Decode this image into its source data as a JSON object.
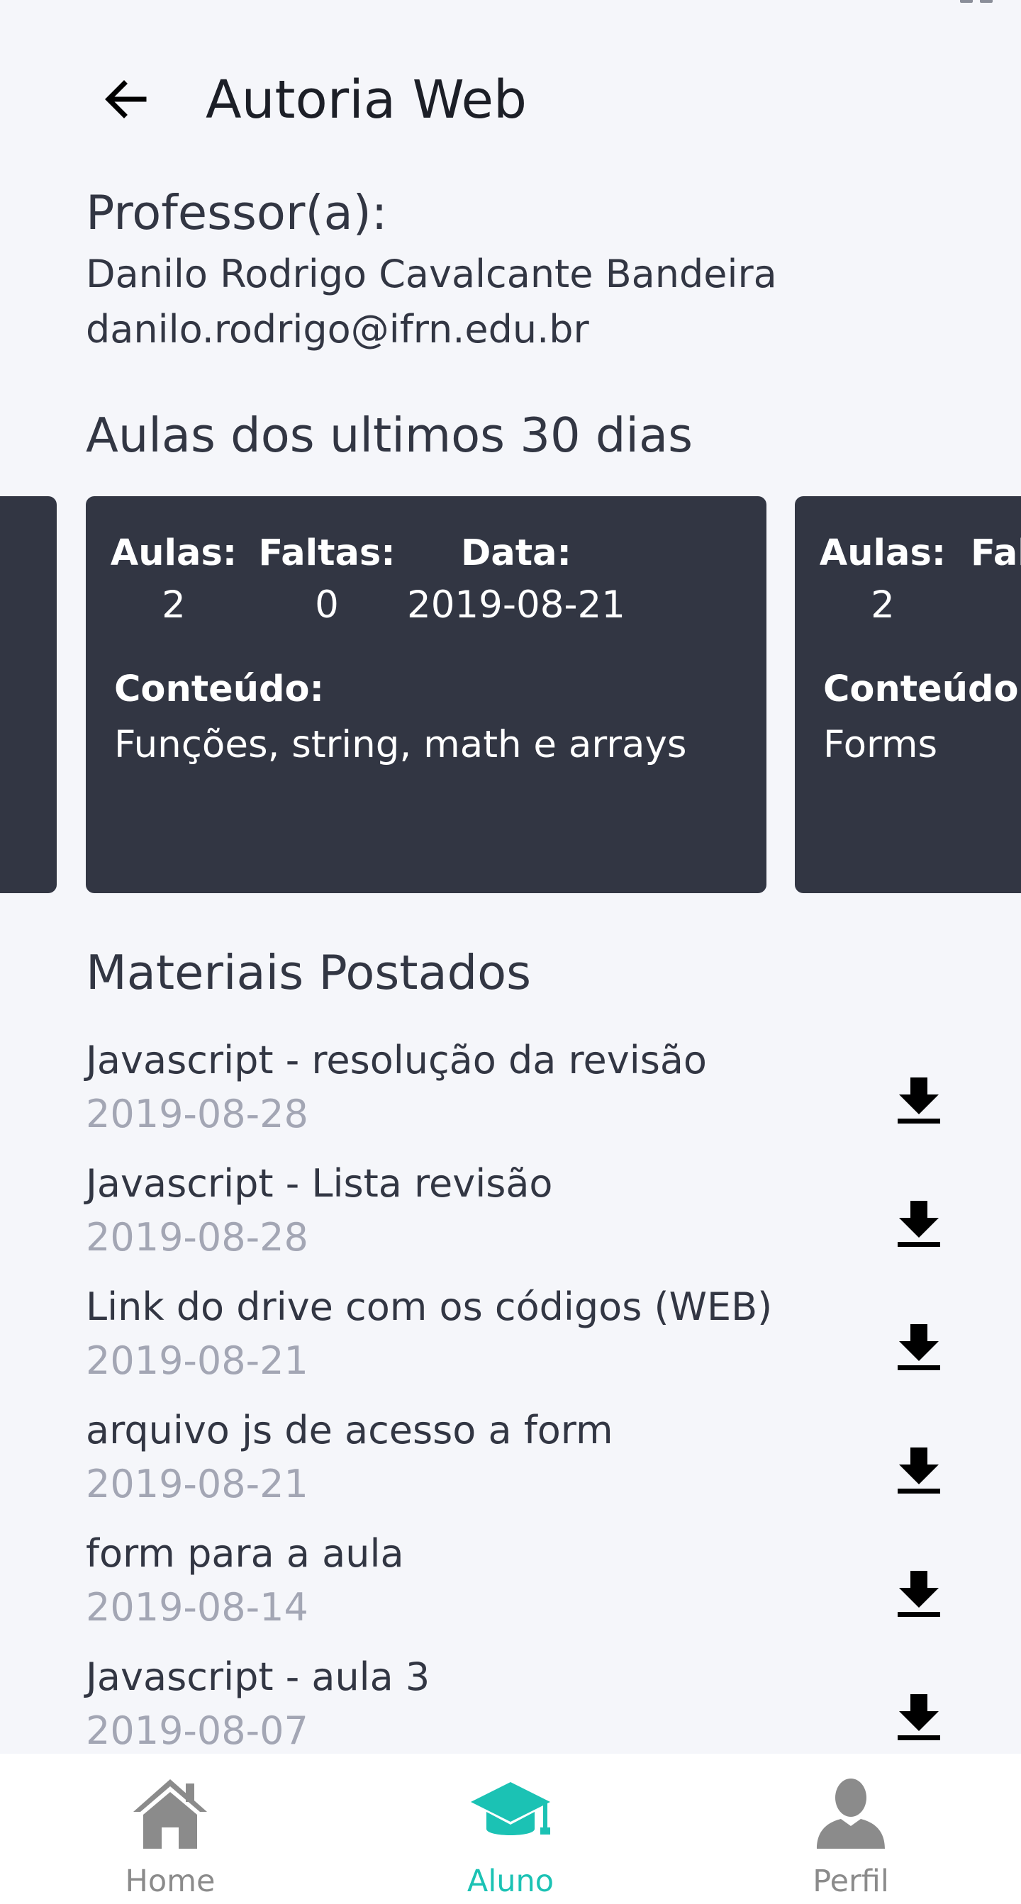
{
  "header": {
    "title": "Autoria Web"
  },
  "professor": {
    "label": "Professor(a):",
    "name": "Danilo Rodrigo Cavalcante Bandeira",
    "email": "danilo.rodrigo@ifrn.edu.br"
  },
  "aulas": {
    "title": "Aulas dos ultimos 30 dias",
    "cards": [
      {
        "aulas_label": "Aulas:",
        "aulas_value": "2",
        "faltas_label": "Faltas:",
        "faltas_value": "0",
        "data_label": "Data:",
        "data_value": "2019-08-21",
        "conteudo_label": "Conteúdo:",
        "conteudo_value": "Funções, string, math e arrays"
      },
      {
        "aulas_label": "Aulas:",
        "aulas_value": "2",
        "faltas_label": "Fal",
        "conteudo_label": "Conteúdo:",
        "conteudo_value": "Forms"
      }
    ]
  },
  "materiais": {
    "title": "Materiais Postados",
    "items": [
      {
        "name": "Javascript - resolução da revisão",
        "date": "2019-08-28"
      },
      {
        "name": "Javascript - Lista revisão",
        "date": "2019-08-28"
      },
      {
        "name": "Link do drive com os códigos (WEB)",
        "date": "2019-08-21"
      },
      {
        "name": "arquivo js de acesso a form",
        "date": "2019-08-21"
      },
      {
        "name": "form para a aula",
        "date": "2019-08-14"
      },
      {
        "name": "Javascript - aula 3",
        "date": "2019-08-07"
      }
    ]
  },
  "tabs": {
    "home": "Home",
    "aluno": "Aluno",
    "perfil": "Perfil",
    "active_color": "#1bc2b4",
    "inactive_color": "#8b8b8b"
  },
  "colors": {
    "card_bg": "#323643",
    "page_bg": "#f5f6fa",
    "date_text": "#a3a6b4"
  }
}
